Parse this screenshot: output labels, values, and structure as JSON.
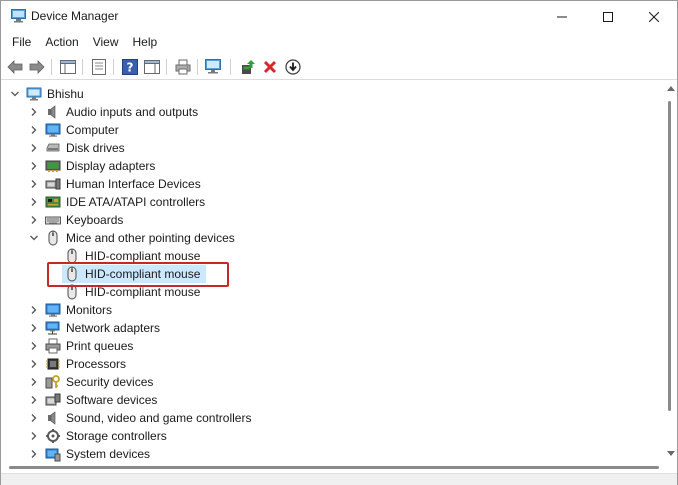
{
  "window": {
    "title": "Device Manager",
    "controls": [
      "minimize",
      "maximize",
      "close"
    ]
  },
  "menu": {
    "items": [
      "File",
      "Action",
      "View",
      "Help"
    ]
  },
  "toolbar": {
    "buttons": [
      "back-icon",
      "forward-icon",
      "show-hide-console-tree-icon",
      "properties-icon",
      "help-icon",
      "action-pane-icon",
      "print-icon",
      "scan-hardware-icon",
      "add-driver-icon",
      "uninstall-icon",
      "update-driver-icon"
    ]
  },
  "tree": {
    "root": "Bhishu",
    "categories": [
      {
        "label": "Audio inputs and outputs",
        "icon": "speaker-icon"
      },
      {
        "label": "Computer",
        "icon": "monitor-icon"
      },
      {
        "label": "Disk drives",
        "icon": "disk-drive-icon"
      },
      {
        "label": "Display adapters",
        "icon": "display-adapter-icon"
      },
      {
        "label": "Human Interface Devices",
        "icon": "hid-icon"
      },
      {
        "label": "IDE ATA/ATAPI controllers",
        "icon": "ide-controller-icon"
      },
      {
        "label": "Keyboards",
        "icon": "keyboard-icon"
      },
      {
        "label": "Mice and other pointing devices",
        "icon": "mouse-icon",
        "expanded": true,
        "children": [
          "HID-compliant mouse",
          "HID-compliant mouse",
          "HID-compliant mouse"
        ],
        "selected_child": 1
      },
      {
        "label": "Monitors",
        "icon": "monitor-icon"
      },
      {
        "label": "Network adapters",
        "icon": "network-icon"
      },
      {
        "label": "Print queues",
        "icon": "printer-icon"
      },
      {
        "label": "Processors",
        "icon": "processor-icon"
      },
      {
        "label": "Security devices",
        "icon": "security-icon"
      },
      {
        "label": "Software devices",
        "icon": "software-device-icon"
      },
      {
        "label": "Sound, video and game controllers",
        "icon": "speaker-icon"
      },
      {
        "label": "Storage controllers",
        "icon": "storage-icon"
      },
      {
        "label": "System devices",
        "icon": "system-device-icon"
      }
    ]
  },
  "colors": {
    "selection": "#cce8ff",
    "highlight_box": "#c62828",
    "uninstall_red": "#d9262c"
  }
}
